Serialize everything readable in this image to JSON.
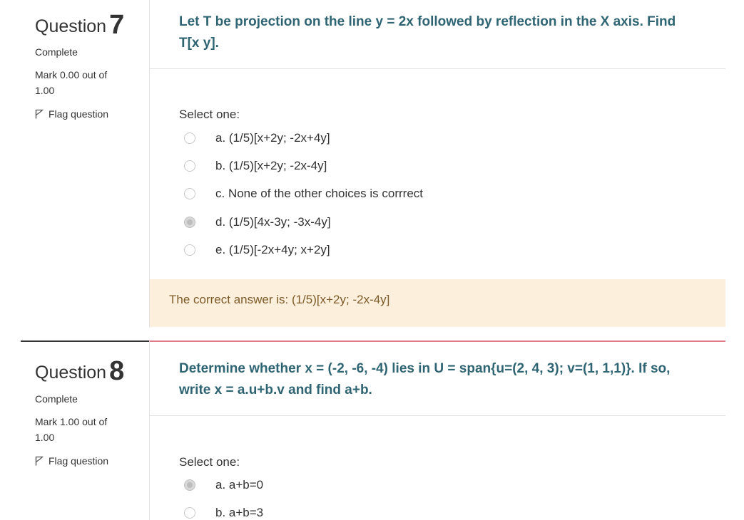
{
  "questions": [
    {
      "label": "Question",
      "number": "7",
      "state": "Complete",
      "grade": "Mark 0.00 out of 1.00",
      "flag": "Flag question",
      "text": "Let T be projection on the line y = 2x followed by reflection in the X axis. Find T[x y].",
      "prompt": "Select one:",
      "options": [
        {
          "label": "a. (1/5)[x+2y; -2x+4y]",
          "checked": false
        },
        {
          "label": "b. (1/5)[x+2y; -2x-4y]",
          "checked": false
        },
        {
          "label": "c. None of the other choices is corrrect",
          "checked": false
        },
        {
          "label": "d. (1/5)[4x-3y; -3x-4y]",
          "checked": true
        },
        {
          "label": "e. (1/5)[-2x+4y; x+2y]",
          "checked": false
        }
      ],
      "feedback": "The correct answer is: (1/5)[x+2y; -2x-4y]"
    },
    {
      "label": "Question",
      "number": "8",
      "state": "Complete",
      "grade": "Mark 1.00 out of 1.00",
      "flag": "Flag question",
      "text": "Determine whether x = (-2, -6, -4) lies in U = span{u=(2, 4, 3); v=(1, 1,1)}. If so, write x = a.u+b.v and find a+b.",
      "prompt": "Select one:",
      "options": [
        {
          "label": "a. a+b=0",
          "checked": true
        },
        {
          "label": "b. a+b=3",
          "checked": false
        }
      ]
    }
  ],
  "colors": {
    "question_text": "#2f6473",
    "feedback_bg": "#fcefdc",
    "feedback_text": "#7d5a29",
    "q8_top_border": "#e07a8a"
  },
  "icons": {
    "flag": "flag-icon"
  }
}
